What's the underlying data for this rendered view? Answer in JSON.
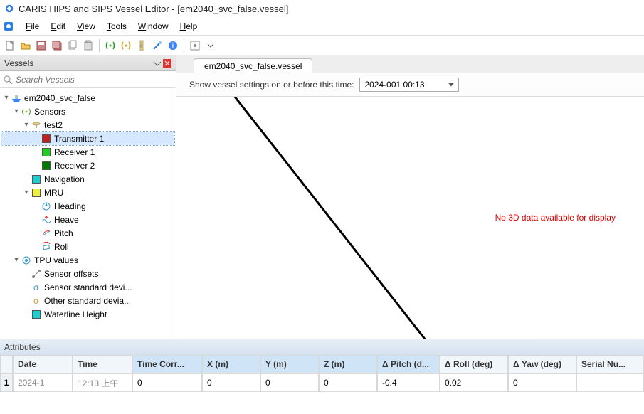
{
  "window": {
    "title": "CARIS HIPS and SIPS Vessel Editor - [em2040_svc_false.vessel]"
  },
  "menubar": [
    "File",
    "Edit",
    "View",
    "Tools",
    "Window",
    "Help"
  ],
  "vessels_panel": {
    "title": "Vessels",
    "search_placeholder": "Search Vessels"
  },
  "tree": {
    "root": "em2040_svc_false",
    "sensors": "Sensors",
    "device": "test2",
    "transmitter1": "Transmitter 1",
    "receiver1": "Receiver 1",
    "receiver2": "Receiver 2",
    "navigation": "Navigation",
    "mru": "MRU",
    "heading": "Heading",
    "heave": "Heave",
    "pitch": "Pitch",
    "roll": "Roll",
    "tpu": "TPU values",
    "sensor_offsets": "Sensor offsets",
    "sensor_std": "Sensor standard devi...",
    "other_std": "Other standard devia...",
    "waterline": "Waterline Height"
  },
  "tab": {
    "label": "em2040_svc_false.vessel"
  },
  "settings": {
    "label": "Show vessel settings on or before this time:",
    "value": "2024-001 00:13"
  },
  "viewer": {
    "no3d": "No 3D data available for display"
  },
  "attributes": {
    "title": "Attributes",
    "columns": [
      "Date",
      "Time",
      "Time Corr...",
      "X (m)",
      "Y (m)",
      "Z (m)",
      "Δ Pitch (d...",
      "Δ Roll (deg)",
      "Δ Yaw (deg)",
      "Serial Nu..."
    ],
    "row_index": "1",
    "row": {
      "date": "2024-1",
      "time": "12:13 上午",
      "time_corr": "0",
      "x": "0",
      "y": "0",
      "z": "0",
      "dpitch": "-0.4",
      "droll": "0.02",
      "dyaw": "0",
      "serial": ""
    }
  }
}
